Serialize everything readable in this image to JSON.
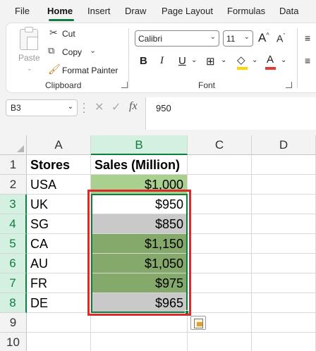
{
  "tabs": [
    "File",
    "Home",
    "Insert",
    "Draw",
    "Page Layout",
    "Formulas",
    "Data"
  ],
  "active_tab": "Home",
  "clipboard": {
    "paste_label": "Paste",
    "cut_label": "Cut",
    "copy_label": "Copy",
    "format_painter_label": "Format Painter",
    "group_label": "Clipboard"
  },
  "font": {
    "name": "Calibri",
    "size": "11",
    "bold": "B",
    "italic": "I",
    "underline": "U",
    "grow": "A",
    "shrink": "A",
    "color_letter": "A",
    "group_label": "Font",
    "fill_color": "#ffd400",
    "font_color": "#e53935"
  },
  "formula_bar": {
    "name_box": "B3",
    "fx": "fx",
    "value": "950"
  },
  "sheet": {
    "columns": [
      "A",
      "B",
      "C",
      "D"
    ],
    "selected_column": "B",
    "rows": [
      "1",
      "2",
      "3",
      "4",
      "5",
      "6",
      "7",
      "8",
      "9",
      "10"
    ],
    "selected_rows": [
      "3",
      "4",
      "5",
      "6",
      "7",
      "8"
    ],
    "headers": {
      "a": "Stores",
      "b": "Sales (Million)"
    },
    "data": [
      {
        "store": "USA",
        "sales": "$1,000",
        "fill": "#a9d08e"
      },
      {
        "store": "UK",
        "sales": "$950",
        "fill": "#ffffff"
      },
      {
        "store": "SG",
        "sales": "$850",
        "fill": "#c9c9c9"
      },
      {
        "store": "CA",
        "sales": "$1,150",
        "fill": "#84a96a"
      },
      {
        "store": "AU",
        "sales": "$1,050",
        "fill": "#84a96a"
      },
      {
        "store": "FR",
        "sales": "$975",
        "fill": "#84a96a"
      },
      {
        "store": "DE",
        "sales": "$965",
        "fill": "#c9c9c9"
      }
    ]
  },
  "colors": {
    "accent": "#107c41",
    "highlight_box": "#d92b2b"
  }
}
